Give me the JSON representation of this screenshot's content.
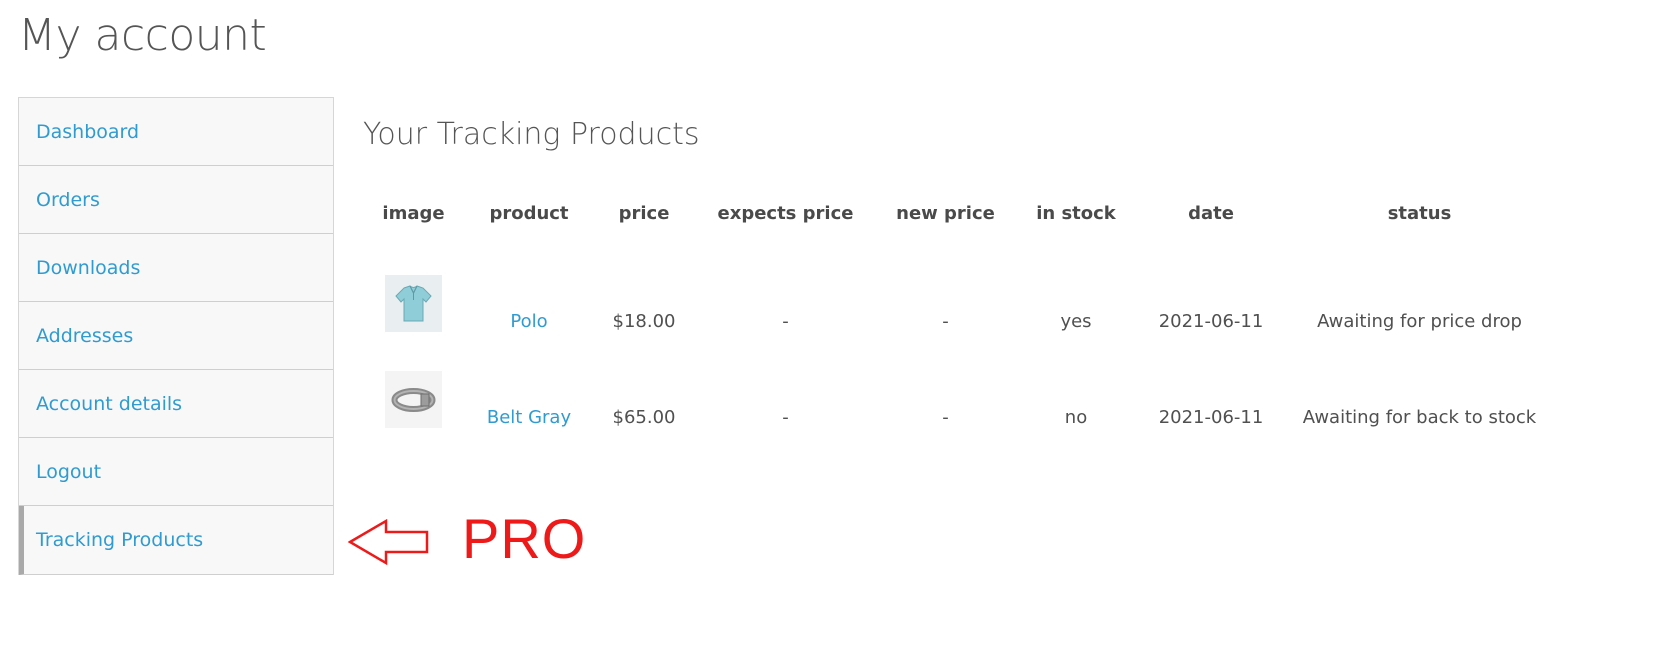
{
  "page": {
    "title": "My account"
  },
  "nav": {
    "items": [
      {
        "label": "Dashboard"
      },
      {
        "label": "Orders"
      },
      {
        "label": "Downloads"
      },
      {
        "label": "Addresses"
      },
      {
        "label": "Account details"
      },
      {
        "label": "Logout"
      },
      {
        "label": "Tracking Products",
        "active": true
      }
    ]
  },
  "tracking": {
    "title": "Your Tracking Products",
    "columns": [
      "image",
      "product",
      "price",
      "expects price",
      "new price",
      "in stock",
      "date",
      "status"
    ],
    "rows": [
      {
        "image_icon": "polo-shirt-thumbnail",
        "product": "Polo",
        "price": "$18.00",
        "expects_price": "-",
        "new_price": "-",
        "in_stock": "yes",
        "date": "2021-06-11",
        "status": "Awaiting for price drop"
      },
      {
        "image_icon": "belt-thumbnail",
        "product": "Belt Gray",
        "price": "$65.00",
        "expects_price": "-",
        "new_price": "-",
        "in_stock": "no",
        "date": "2021-06-11",
        "status": "Awaiting for back to stock"
      }
    ]
  },
  "annotation": {
    "label": "PRO",
    "arrow_icon": "left-arrow-outline-icon",
    "color": "#ee1a1a"
  },
  "colors": {
    "link": "#2f9bd1",
    "nav_bg": "#f8f8f8",
    "text": "#515151"
  }
}
